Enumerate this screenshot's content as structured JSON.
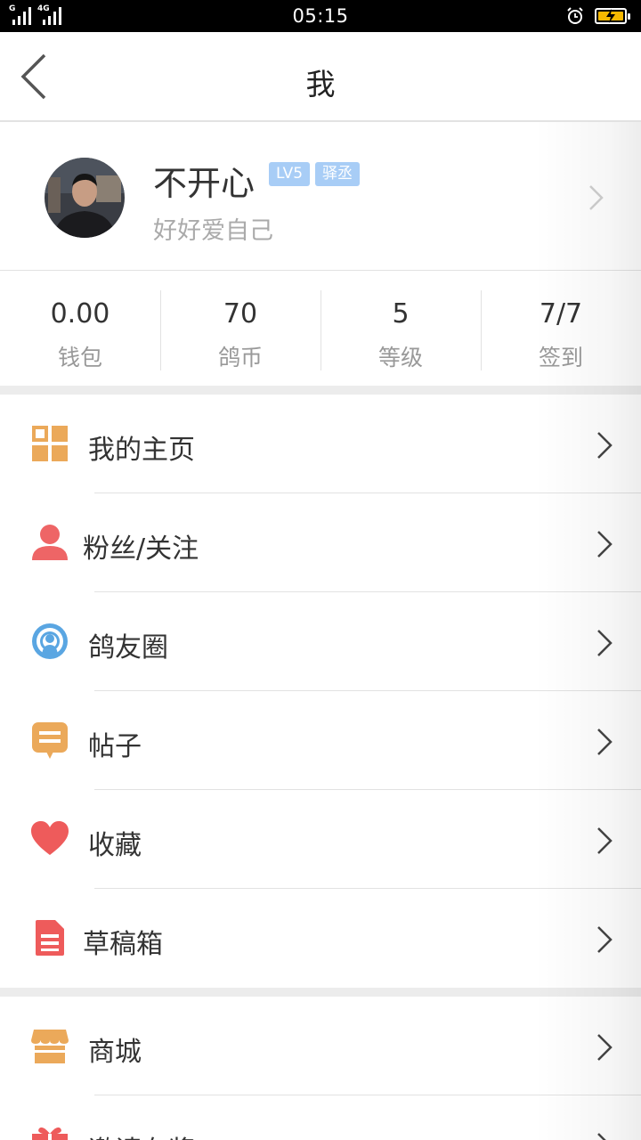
{
  "status_bar": {
    "time": "05:15",
    "sim1_label": "G",
    "sim2_label": "4G",
    "battery_color": "#f5b800"
  },
  "header": {
    "title": "我"
  },
  "profile": {
    "name": "不开心",
    "level_badge": "LV5",
    "role_badge": "驿丞",
    "signature": "好好爱自己",
    "badge_color": "#a8cdf6"
  },
  "stats": [
    {
      "value": "0.00",
      "label": "钱包"
    },
    {
      "value": "70",
      "label": "鸽币"
    },
    {
      "value": "5",
      "label": "等级"
    },
    {
      "value": "7/7",
      "label": "签到"
    }
  ],
  "menu": [
    {
      "label": "我的主页",
      "icon": "grid-icon",
      "color": "#eba95a"
    },
    {
      "label": "粉丝/关注",
      "icon": "person-icon",
      "color": "#ee6566"
    },
    {
      "label": "鸽友圈",
      "icon": "broadcast-icon",
      "color": "#5aa6e2"
    },
    {
      "label": "帖子",
      "icon": "message-icon",
      "color": "#eba95a"
    },
    {
      "label": "收藏",
      "icon": "heart-icon",
      "color": "#ee5b5b"
    },
    {
      "label": "草稿箱",
      "icon": "document-icon",
      "color": "#ee5b5b"
    },
    {
      "label": "商城",
      "icon": "store-icon",
      "color": "#eba95a"
    },
    {
      "label": "邀请有奖",
      "icon": "gift-icon",
      "color": "#ee5b5b"
    }
  ]
}
